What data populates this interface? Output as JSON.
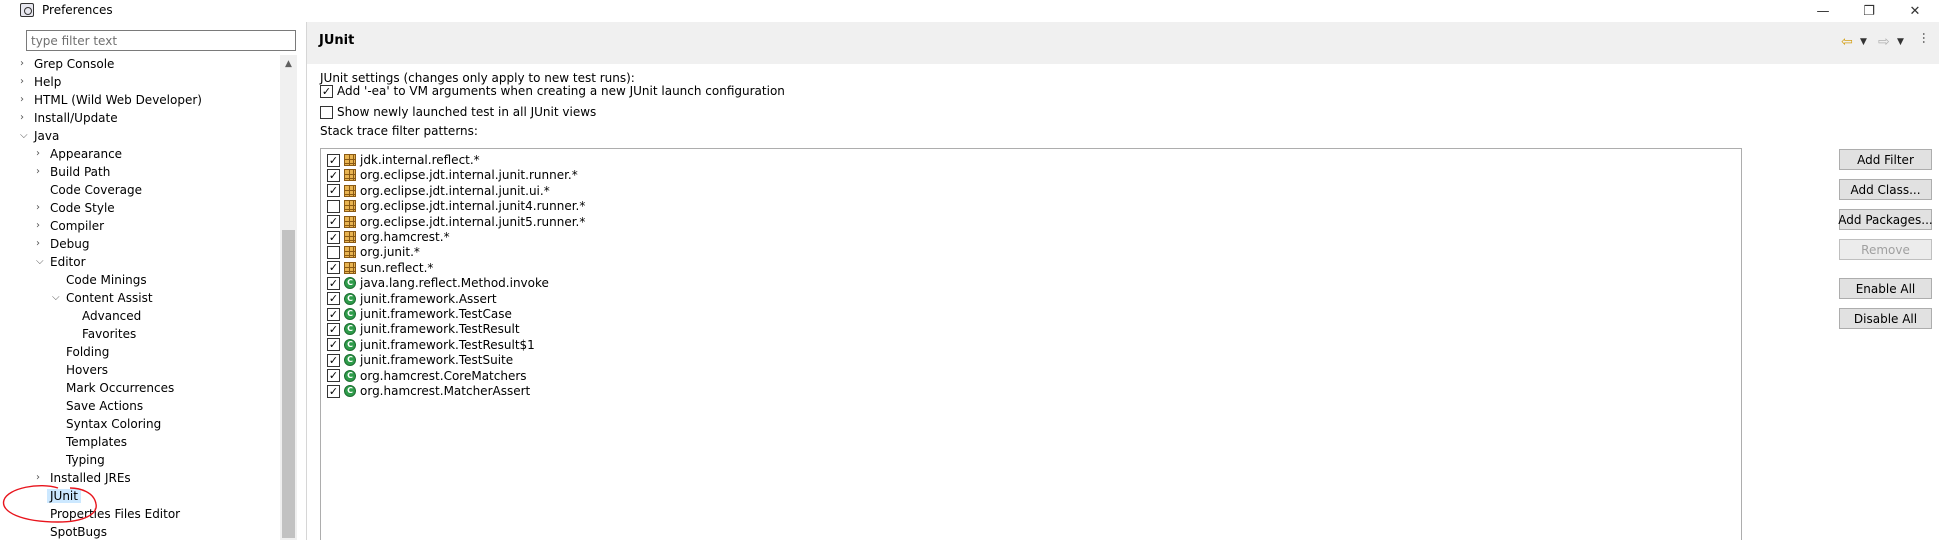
{
  "window": {
    "title": "Preferences",
    "minimize_glyph": "—",
    "maximize_glyph": "❐",
    "close_glyph": "✕"
  },
  "left": {
    "filter_placeholder": "type filter text",
    "tree": [
      {
        "label": "Grep Console",
        "level": 1,
        "expander": "collapsed"
      },
      {
        "label": "Help",
        "level": 1,
        "expander": "collapsed"
      },
      {
        "label": "HTML (Wild Web Developer)",
        "level": 1,
        "expander": "collapsed"
      },
      {
        "label": "Install/Update",
        "level": 1,
        "expander": "collapsed"
      },
      {
        "label": "Java",
        "level": 1,
        "expander": "expanded"
      },
      {
        "label": "Appearance",
        "level": 2,
        "expander": "collapsed"
      },
      {
        "label": "Build Path",
        "level": 2,
        "expander": "collapsed"
      },
      {
        "label": "Code Coverage",
        "level": 2,
        "expander": "none"
      },
      {
        "label": "Code Style",
        "level": 2,
        "expander": "collapsed"
      },
      {
        "label": "Compiler",
        "level": 2,
        "expander": "collapsed"
      },
      {
        "label": "Debug",
        "level": 2,
        "expander": "collapsed"
      },
      {
        "label": "Editor",
        "level": 2,
        "expander": "expanded"
      },
      {
        "label": "Code Minings",
        "level": 3,
        "expander": "none"
      },
      {
        "label": "Content Assist",
        "level": 3,
        "expander": "expanded"
      },
      {
        "label": "Advanced",
        "level": 4,
        "expander": "none"
      },
      {
        "label": "Favorites",
        "level": 4,
        "expander": "none"
      },
      {
        "label": "Folding",
        "level": 3,
        "expander": "none"
      },
      {
        "label": "Hovers",
        "level": 3,
        "expander": "none"
      },
      {
        "label": "Mark Occurrences",
        "level": 3,
        "expander": "none"
      },
      {
        "label": "Save Actions",
        "level": 3,
        "expander": "none"
      },
      {
        "label": "Syntax Coloring",
        "level": 3,
        "expander": "none"
      },
      {
        "label": "Templates",
        "level": 3,
        "expander": "none"
      },
      {
        "label": "Typing",
        "level": 3,
        "expander": "none"
      },
      {
        "label": "Installed JREs",
        "level": 2,
        "expander": "collapsed"
      },
      {
        "label": "JUnit",
        "level": 2,
        "expander": "none",
        "selected": true
      },
      {
        "label": "Properties Files Editor",
        "level": 2,
        "expander": "none"
      },
      {
        "label": "SpotBugs",
        "level": 2,
        "expander": "none"
      }
    ],
    "annotation_color": "#e8141c"
  },
  "page": {
    "title": "JUnit",
    "settings_label": "JUnit settings (changes only apply to new test runs):",
    "options": [
      {
        "label": "Add '-ea' to VM arguments when creating a new JUnit launch configuration",
        "checked": true
      },
      {
        "label": "Show newly launched test in all JUnit views",
        "checked": false
      }
    ],
    "filter_patterns_label": "Stack trace filter patterns:",
    "filters": [
      {
        "pattern": "jdk.internal.reflect.*",
        "checked": true,
        "kind": "package"
      },
      {
        "pattern": "org.eclipse.jdt.internal.junit.runner.*",
        "checked": true,
        "kind": "package"
      },
      {
        "pattern": "org.eclipse.jdt.internal.junit.ui.*",
        "checked": true,
        "kind": "package"
      },
      {
        "pattern": "org.eclipse.jdt.internal.junit4.runner.*",
        "checked": false,
        "kind": "package"
      },
      {
        "pattern": "org.eclipse.jdt.internal.junit5.runner.*",
        "checked": true,
        "kind": "package"
      },
      {
        "pattern": "org.hamcrest.*",
        "checked": true,
        "kind": "package"
      },
      {
        "pattern": "org.junit.*",
        "checked": false,
        "kind": "package"
      },
      {
        "pattern": "sun.reflect.*",
        "checked": true,
        "kind": "package"
      },
      {
        "pattern": "java.lang.reflect.Method.invoke",
        "checked": true,
        "kind": "class"
      },
      {
        "pattern": "junit.framework.Assert",
        "checked": true,
        "kind": "class"
      },
      {
        "pattern": "junit.framework.TestCase",
        "checked": true,
        "kind": "class"
      },
      {
        "pattern": "junit.framework.TestResult",
        "checked": true,
        "kind": "class"
      },
      {
        "pattern": "junit.framework.TestResult$1",
        "checked": true,
        "kind": "class"
      },
      {
        "pattern": "junit.framework.TestSuite",
        "checked": true,
        "kind": "class"
      },
      {
        "pattern": "org.hamcrest.CoreMatchers",
        "checked": true,
        "kind": "class"
      },
      {
        "pattern": "org.hamcrest.MatcherAssert",
        "checked": true,
        "kind": "class"
      }
    ],
    "buttons": {
      "add_filter": "Add Filter",
      "add_class": "Add Class...",
      "add_packages": "Add Packages...",
      "remove": "Remove",
      "enable_all": "Enable All",
      "disable_all": "Disable All"
    }
  }
}
